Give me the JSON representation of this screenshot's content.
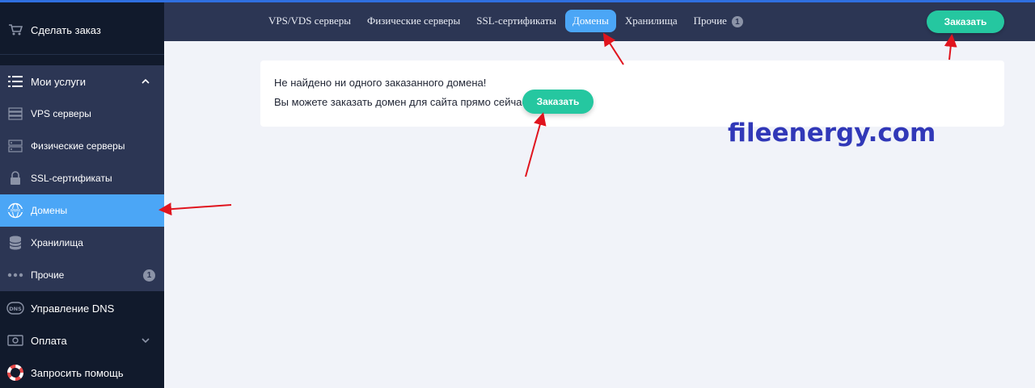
{
  "sidebar": {
    "order_label": "Сделать заказ",
    "group_label": "Мои услуги",
    "items": [
      {
        "label": "VPS серверы",
        "icon": "server-icon"
      },
      {
        "label": "Физические серверы",
        "icon": "rack-server-icon"
      },
      {
        "label": "SSL-сертификаты",
        "icon": "lock-icon"
      },
      {
        "label": "Домены",
        "icon": "www-globe-icon",
        "active": true
      },
      {
        "label": "Хранилища",
        "icon": "database-icon"
      },
      {
        "label": "Прочие",
        "icon": "dots-icon",
        "badge": "1"
      }
    ],
    "dns_label": "Управление DNS",
    "payment_label": "Оплата",
    "help_label": "Запросить помощь"
  },
  "topnav": {
    "tabs": [
      {
        "label": "VPS/VDS серверы"
      },
      {
        "label": "Физические серверы"
      },
      {
        "label": "SSL-сертификаты"
      },
      {
        "label": "Домены",
        "active": true
      },
      {
        "label": "Хранилища"
      },
      {
        "label": "Прочие",
        "badge": "1"
      }
    ],
    "order_button": "Заказать"
  },
  "content": {
    "message1": "Не найдено ни одного заказанного домена!",
    "message2": "Вы можете заказать домен для сайта прямо сейчас:",
    "order_button": "Заказать"
  },
  "watermark": "fileenergy.com",
  "colors": {
    "sidebar_bg": "#111a2c",
    "group_bg": "#2c3654",
    "active": "#4ba6f6",
    "accent_green": "#25c7a0",
    "arrow": "#e0141e"
  }
}
